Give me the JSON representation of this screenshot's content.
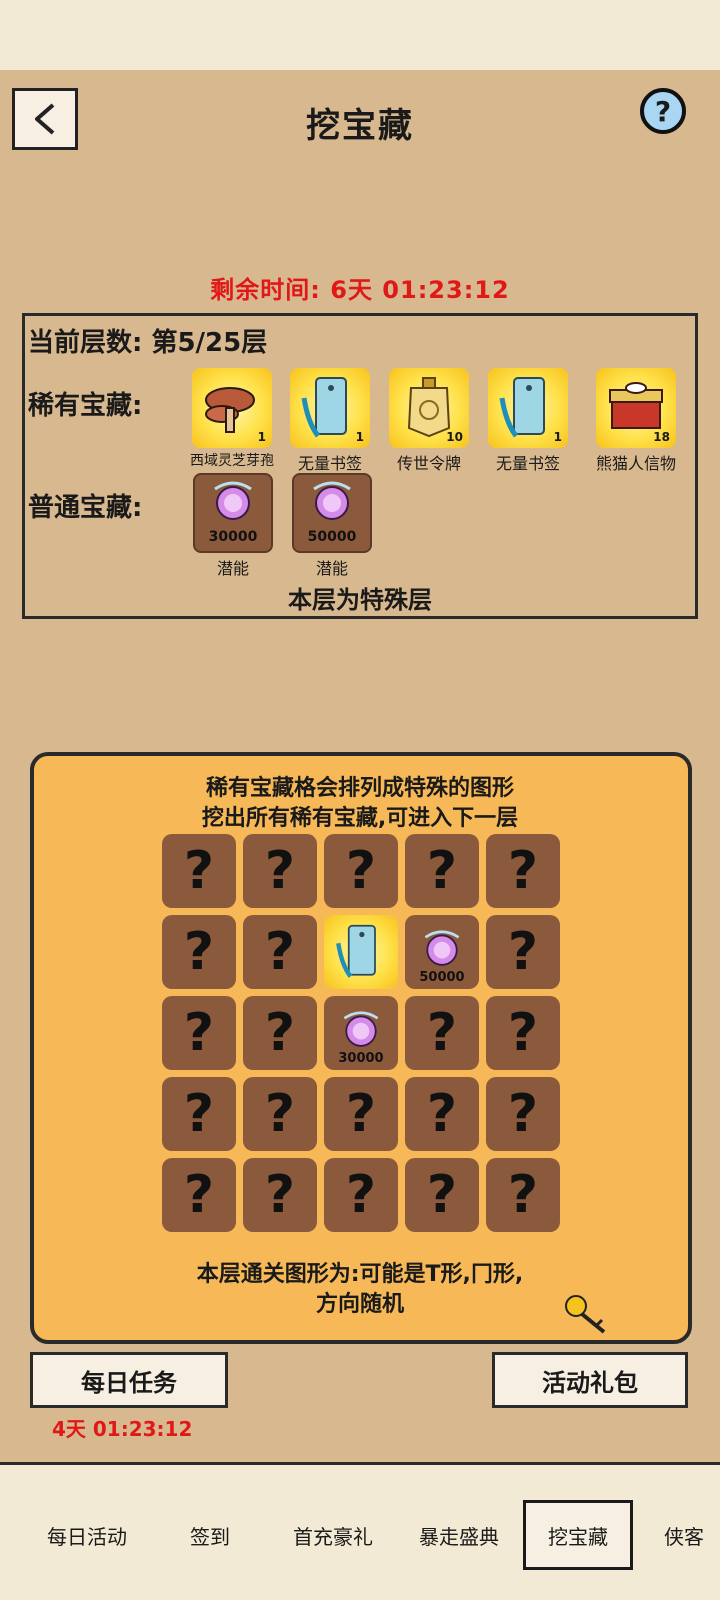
{
  "header": {
    "title": "挖宝藏",
    "help_glyph": "?"
  },
  "timer": {
    "label": "剩余时间:",
    "value": "6天 01:23:12"
  },
  "floor": {
    "label": "当前层数:",
    "value": "第5/25层"
  },
  "rare": {
    "label": "稀有宝藏:",
    "items": [
      {
        "name": "西域灵芝芽孢",
        "count": "1",
        "icon": "mushroom-icon"
      },
      {
        "name": "无量书签",
        "count": "1",
        "icon": "bookmark-icon"
      },
      {
        "name": "传世令牌",
        "count": "10",
        "icon": "token-icon"
      },
      {
        "name": "无量书签",
        "count": "1",
        "icon": "bookmark-icon"
      },
      {
        "name": "熊猫人信物",
        "count": "18",
        "icon": "chest-icon"
      }
    ]
  },
  "normal": {
    "label": "普通宝藏:",
    "items": [
      {
        "name": "潜能",
        "count": "30000",
        "icon": "potential-orb-icon"
      },
      {
        "name": "潜能",
        "count": "50000",
        "icon": "potential-orb-icon"
      }
    ]
  },
  "special_note": "本层为特殊层",
  "panel": {
    "hint_line1": "稀有宝藏格会排列成特殊的图形",
    "hint_line2": "挖出所有稀有宝藏,可进入下一层",
    "footer_line1": "本层通关图形为:可能是T形,冂形,",
    "footer_line2": "方向随机",
    "unknown_glyph": "?",
    "opened": [
      {
        "row": 1,
        "col": 2,
        "type": "rare",
        "icon": "bookmark-icon",
        "value": ""
      },
      {
        "row": 1,
        "col": 3,
        "type": "normal",
        "icon": "potential-orb-icon",
        "value": "50000"
      },
      {
        "row": 2,
        "col": 2,
        "type": "normal",
        "icon": "potential-orb-icon",
        "value": "30000"
      }
    ]
  },
  "buttons": {
    "daily_task": "每日任务",
    "daily_timer": "4天 01:23:12",
    "gift_pack": "活动礼包"
  },
  "tabs": [
    {
      "label": "每日活动",
      "active": false
    },
    {
      "label": "签到",
      "active": false
    },
    {
      "label": "首充豪礼",
      "active": false
    },
    {
      "label": "暴走盛典",
      "active": false
    },
    {
      "label": "挖宝藏",
      "active": true
    },
    {
      "label": "侠客",
      "active": false
    }
  ],
  "colors": {
    "timer_red": "#e01818",
    "panel_orange": "#f7b958",
    "cell_brown": "#8b5a3c",
    "page_tan": "#d8b88e"
  }
}
